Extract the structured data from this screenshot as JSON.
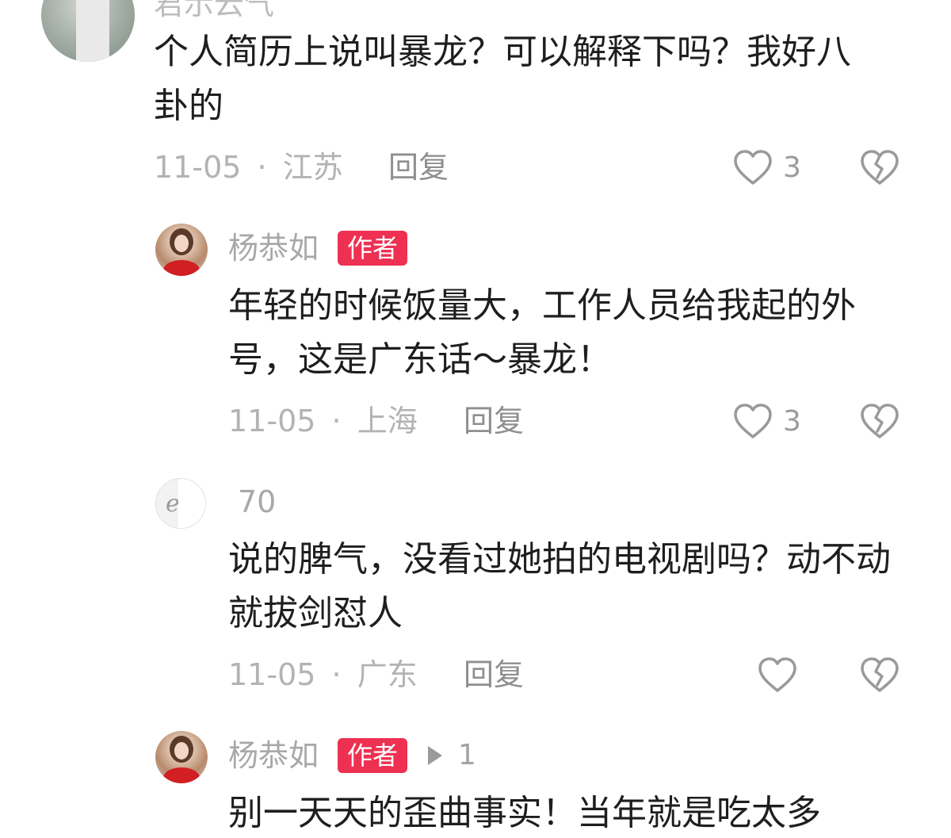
{
  "comments": [
    {
      "username": "君示云气",
      "text": "个人简历上说叫暴龙？可以解释下吗？我好八卦的",
      "date": "11-05",
      "separator": "·",
      "location": "江苏",
      "reply_label": "回复",
      "likes": "3"
    },
    {
      "username": "杨恭如",
      "badge": "作者",
      "text": "年轻的时候饭量大，工作人员给我起的外号，这是广东话～暴龙！",
      "date": "11-05",
      "separator": "·",
      "location": "上海",
      "reply_label": "回复",
      "likes": "3"
    },
    {
      "username": "70",
      "text": "说的脾气，没看过她拍的电视剧吗？动不动就拔剑怼人",
      "date": "11-05",
      "separator": "·",
      "location": "广东",
      "reply_label": "回复",
      "likes": ""
    },
    {
      "username": "杨恭如",
      "badge": "作者",
      "reply_to": "1",
      "text": "别一天天的歪曲事实！当年就是吃太多"
    }
  ],
  "icons": {
    "like": "heart-outline-icon",
    "dislike": "broken-heart-icon",
    "reply_to_arrow": "play-arrow-icon"
  },
  "colors": {
    "badge_bg": "#ee3152",
    "text_primary": "#1e1e1e",
    "text_meta": "#b3b3b3",
    "username": "#a8a8a8"
  }
}
